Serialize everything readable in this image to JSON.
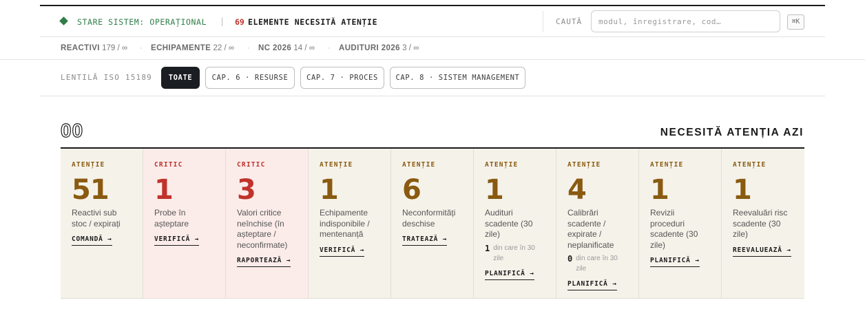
{
  "status": {
    "label": "STARE SISTEM: OPERAȚIONAL",
    "separator": "|",
    "attention_count": "69",
    "attention_text": "ELEMENTE NECESITĂ ATENȚIE",
    "color": "#2f7d47"
  },
  "search": {
    "label": "CAUTĂ",
    "placeholder": "modul, înregistrare, cod…",
    "shortcut": "⌘K"
  },
  "counts": [
    {
      "label": "REACTIVI",
      "value": "179 / ∞"
    },
    {
      "label": "ECHIPAMENTE",
      "value": "22 / ∞"
    },
    {
      "label": "NC 2026",
      "value": "14 / ∞"
    },
    {
      "label": "AUDITURI 2026",
      "value": "3 / ∞"
    }
  ],
  "counts_separator": "·",
  "lens": {
    "label": "LENTILĂ ISO 15189",
    "options": [
      {
        "label": "TOATE",
        "active": true
      },
      {
        "label": "CAP. 6 · RESURSE",
        "active": false
      },
      {
        "label": "CAP. 7 · PROCES",
        "active": false
      },
      {
        "label": "CAP. 8 · SISTEM MANAGEMENT",
        "active": false
      }
    ]
  },
  "section": {
    "number": "00",
    "title": "NECESITĂ ATENȚIA AZI"
  },
  "colors": {
    "attention": "#8a5a10",
    "critical": "#c0332b",
    "card_bg": "#f5f2ea",
    "critical_bg": "#fbecea"
  },
  "cards": [
    {
      "level": "ATENȚIE",
      "value": "51",
      "label": "Reactivi sub stoc / expirați",
      "action": "COMANDĂ →"
    },
    {
      "level": "CRITIC",
      "value": "1",
      "label": "Probe în așteptare",
      "action": "VERIFICĂ →"
    },
    {
      "level": "CRITIC",
      "value": "3",
      "label": "Valori critice neînchise (în așteptare / neconfirmate)",
      "action": "RAPORTEAZĂ →"
    },
    {
      "level": "ATENȚIE",
      "value": "1",
      "label": "Echipamente indisponibile / mentenanță",
      "action": "VERIFICĂ →"
    },
    {
      "level": "ATENȚIE",
      "value": "6",
      "label": "Neconformități deschise",
      "action": "TRATEAZĂ →"
    },
    {
      "level": "ATENȚIE",
      "value": "1",
      "label": "Audituri scadente (30 zile)",
      "sub_value": "1",
      "sub_text": "din care în 30 zile",
      "action": "PLANIFICĂ →"
    },
    {
      "level": "ATENȚIE",
      "value": "4",
      "label": "Calibrări scadente / expirate / neplanificate",
      "sub_value": "0",
      "sub_text": "din care în 30 zile",
      "action": "PLANIFICĂ →"
    },
    {
      "level": "ATENȚIE",
      "value": "1",
      "label": "Revizii proceduri scadente (30 zile)",
      "action": "PLANIFICĂ →"
    },
    {
      "level": "ATENȚIE",
      "value": "1",
      "label": "Reevaluări risc scadente (30 zile)",
      "action": "REEVALUEAZĂ →"
    }
  ]
}
